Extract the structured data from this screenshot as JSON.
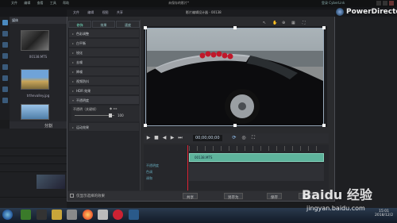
{
  "top": {
    "menu": [
      "文件",
      "编辑",
      "查看",
      "工具",
      "帮助"
    ],
    "title": "未保存的影片*",
    "signin": "登录 CyberLink",
    "brand": "PowerDirector"
  },
  "media": {
    "tabs": [
      "媒体"
    ],
    "items": [
      {
        "label": "00138.MTS"
      },
      {
        "label": "trthevalley.jpg"
      },
      {
        "label": "视频素材"
      }
    ],
    "split_label": "分割"
  },
  "designer": {
    "title": "影片编辑设计器 - 00138",
    "menu": [
      "文件",
      "编辑",
      "视图",
      "共享"
    ],
    "tabs": [
      "修饰",
      "效果",
      "速度"
    ],
    "rows": [
      "色彩调整",
      "白平衡",
      "锐化",
      "去噪",
      "降噪",
      "视频防抖",
      "HDR 效果",
      "不透明度",
      "运动效果"
    ],
    "opacity_label": "不透明（关键帧）",
    "opacity_value": "100",
    "timecode": "00;00;00;00",
    "clip_label": "00138.MTS",
    "tracks": [
      "不透明度",
      "色调",
      "调和"
    ],
    "checkbox_label": "仅显示选择的效果",
    "buttons": [
      "共享",
      "另存为",
      "保存",
      "取消"
    ]
  },
  "taskbar": {
    "time": "15:01",
    "date": "2018/12/2"
  },
  "watermark": {
    "line1": "Baidu 经验",
    "line2": "jingyan.baidu.com"
  }
}
